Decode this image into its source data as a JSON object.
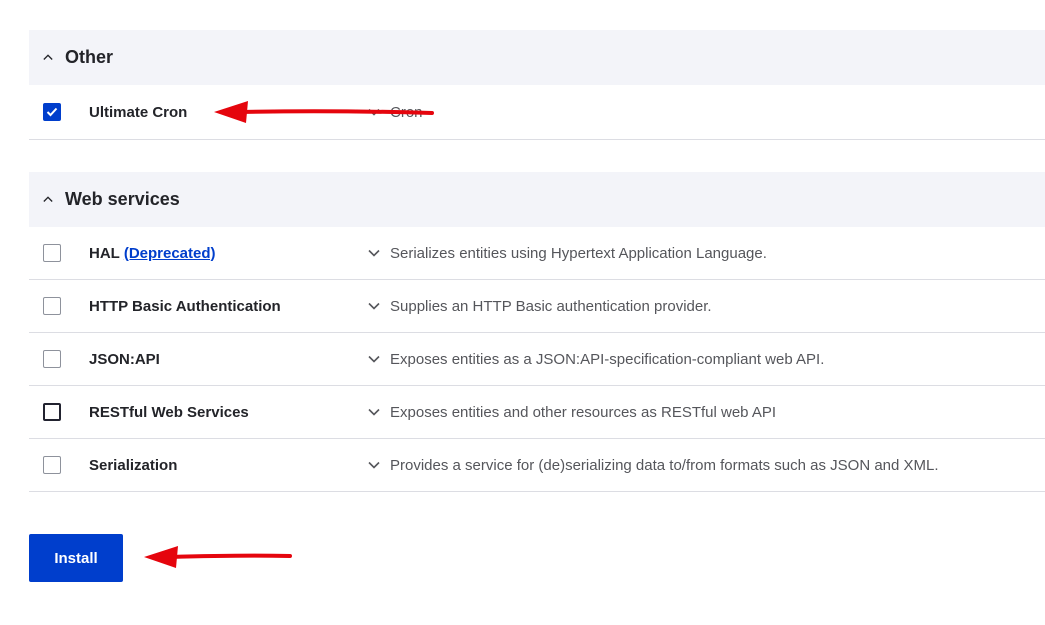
{
  "sections": [
    {
      "title": "Other",
      "modules": [
        {
          "name": "Ultimate Cron",
          "link": "",
          "description": "Cron",
          "checked": true
        }
      ]
    },
    {
      "title": "Web services",
      "modules": [
        {
          "name": "HAL",
          "link": "(Deprecated)",
          "description": "Serializes entities using Hypertext Application Language.",
          "checked": false
        },
        {
          "name": "HTTP Basic Authentication",
          "link": "",
          "description": "Supplies an HTTP Basic authentication provider.",
          "checked": false
        },
        {
          "name": "JSON:API",
          "link": "",
          "description": "Exposes entities as a JSON:API-specification-compliant web API.",
          "checked": false
        },
        {
          "name": "RESTful Web Services",
          "link": "",
          "description": "Exposes entities and other resources as RESTful web API",
          "checked": false
        },
        {
          "name": "Serialization",
          "link": "",
          "description": "Provides a service for (de)serializing data to/from formats such as JSON and XML.",
          "checked": false
        }
      ]
    }
  ],
  "install_label": "Install",
  "colors": {
    "accent": "#003ecc",
    "annotation_arrow": "#e5050d",
    "header_bg": "#f3f4f9"
  },
  "icons": {
    "section_toggle": "chevron-up-icon",
    "description_toggle": "chevron-down-icon",
    "checkmark": "check-icon"
  }
}
